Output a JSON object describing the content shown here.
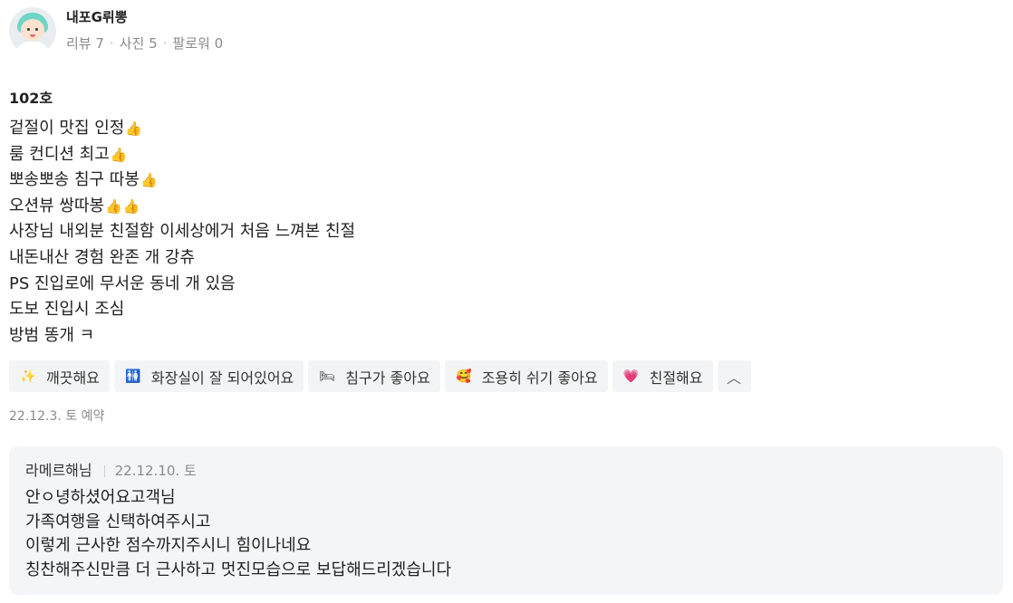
{
  "profile": {
    "nickname": "내포G뤼뽕",
    "reviews": "리뷰 7",
    "photos": "사진 5",
    "followers": "팔로워 0"
  },
  "review": {
    "room": "102호",
    "lines": [
      "겉절이 맛집 인정",
      "룸 컨디션 최고",
      "뽀송뽀송 침구 따봉",
      "오션뷰 쌍따봉",
      "사장님 내외분 친절함 이세상에거 처음 느껴본 친절",
      "내돈내산 경험 완존 개 강츄",
      "PS 진입로에 무서운 동네 개 있음",
      "도보 진입시 조심",
      "방범 똥개 ㅋ"
    ],
    "thumb_icon": "👍",
    "tags": [
      {
        "icon": "sparkles-icon",
        "glyph": "✨",
        "label": "깨끗해요"
      },
      {
        "icon": "restroom-icon",
        "glyph": "🚻",
        "label": "화장실이 잘 되어있어요"
      },
      {
        "icon": "bed-icon",
        "glyph": "🛏",
        "label": "침구가 좋아요"
      },
      {
        "icon": "smiling-face-icon",
        "glyph": "🥰",
        "label": "조용히 쉬기 좋아요"
      },
      {
        "icon": "heart-icon",
        "glyph": "💗",
        "label": "친절해요"
      }
    ],
    "collapse_glyph": "︿",
    "meta": "22.12.3. 토 예약"
  },
  "reply": {
    "name": "라메르해님",
    "date": "22.12.10. 토",
    "lines": [
      "안ㅇ녕하셨어요고객님",
      "가족여행을 신택하여주시고",
      "이렇게 근사한 점수까지주시니 힘이나네요",
      "칭찬해주신만큼 더 근사하고 멋진모습으로 보답해드리겠습니다"
    ]
  }
}
